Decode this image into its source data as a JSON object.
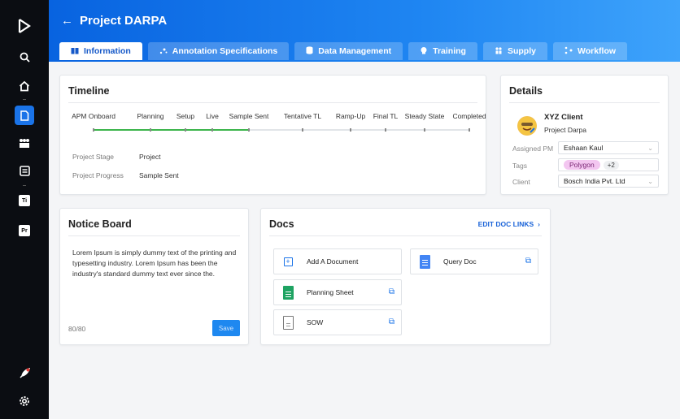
{
  "header": {
    "back_arrow": "←",
    "title": "Project DARPA",
    "colors": {
      "gradient_start": "#0863e0",
      "gradient_end": "#3ea3fb"
    }
  },
  "tabs": [
    {
      "label": "Information",
      "icon": "book-icon",
      "active": true
    },
    {
      "label": "Annotation Specifications",
      "icon": "sparkle-icon",
      "active": false
    },
    {
      "label": "Data Management",
      "icon": "database-icon",
      "active": false
    },
    {
      "label": "Training",
      "icon": "brain-icon",
      "active": false
    },
    {
      "label": "Supply",
      "icon": "people-icon",
      "active": false
    },
    {
      "label": "Workflow",
      "icon": "flow-icon",
      "active": false
    }
  ],
  "sidebar": {
    "items": [
      {
        "icon": "logo-icon"
      },
      {
        "icon": "search-icon"
      },
      {
        "icon": "home-icon"
      },
      {
        "icon": "document-icon",
        "active": true
      },
      {
        "icon": "team-icon"
      },
      {
        "icon": "form-icon"
      },
      {
        "icon": "ti-icon",
        "text": "Ti"
      },
      {
        "icon": "pr-icon",
        "text": "Pr"
      },
      {
        "icon": "rocket-icon"
      },
      {
        "icon": "gear-icon"
      }
    ],
    "accent": "#1a73e8"
  },
  "timeline": {
    "title": "Timeline",
    "stages": [
      "APM Onboard",
      "Planning",
      "Setup",
      "Live",
      "Sample Sent",
      "Tentative TL",
      "Ramp-Up",
      "Final TL",
      "Steady State",
      "Completed"
    ],
    "completed_stage_count": 5,
    "progress_color": "#3cb44b",
    "stage_label": "Project Stage",
    "stage_value": "Project",
    "progress_label": "Project Progress",
    "progress_value": "Sample Sent"
  },
  "details": {
    "title": "Details",
    "client_name": "XYZ Client",
    "project_name": "Project Darpa",
    "assigned_pm_label": "Assigned PM",
    "assigned_pm_value": "Eshaan Kaul",
    "tags_label": "Tags",
    "tag": "Polygon",
    "tag_more": "+2",
    "client_label": "Client",
    "client_value": "Bosch India Pvt. Ltd"
  },
  "notice": {
    "title": "Notice Board",
    "text": "Lorem Ipsum is simply dummy text of the printing and typesetting industry. Lorem Ipsum has been the industry's standard dummy text ever since the.",
    "counter": "80/80",
    "save_label": "Save"
  },
  "docs": {
    "title": "Docs",
    "edit_label": "EDIT DOC LINKS",
    "edit_arrow": "›",
    "add_label": "Add A Document",
    "items": [
      {
        "name": "Query Doc",
        "icon": "google-doc-icon"
      },
      {
        "name": "Planning Sheet",
        "icon": "google-sheet-icon"
      },
      {
        "name": "SOW",
        "icon": "file-icon"
      }
    ]
  }
}
